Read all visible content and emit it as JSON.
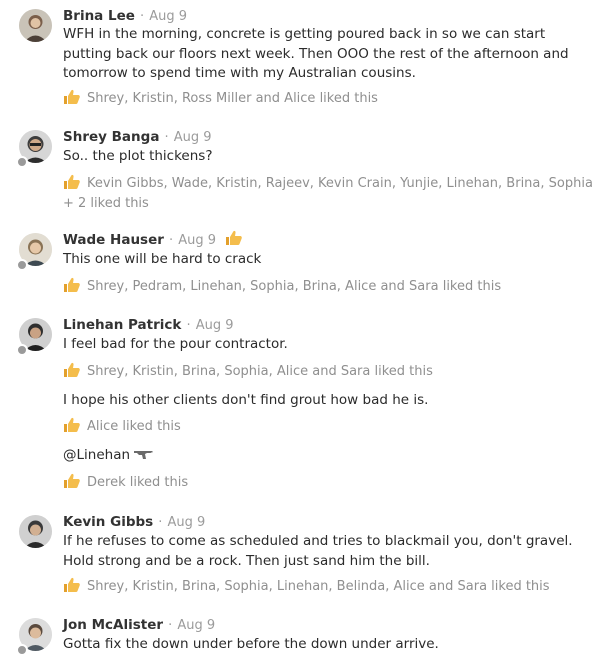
{
  "posts": [
    {
      "author": "Brina Lee",
      "date": "Aug 9",
      "message": "WFH in the morning, concrete is getting poured back in so we can start putting back our floors next week. Then OOO the rest of the afternoon and tomorrow to spend time with my Australian cousins.",
      "likes": "Shrey, Kristin, Ross Miller and Alice liked this"
    },
    {
      "author": "Shrey Banga",
      "date": "Aug 9",
      "message": "So.. the plot thickens?",
      "likes": "Kevin Gibbs, Wade, Kristin, Rajeev, Kevin Crain, Yunjie, Linehan, Brina, Sophia + 2 liked this"
    },
    {
      "author": "Wade Hauser",
      "date": "Aug 9",
      "message": "This one will be hard to crack",
      "likes": "Shrey, Pedram, Linehan, Sophia, Brina, Alice and Sara liked this"
    },
    {
      "author": "Linehan Patrick",
      "date": "Aug 9",
      "message": "I feel bad for the pour contractor.",
      "likes": "Shrey, Kristin, Brina, Sophia, Alice and Sara liked this",
      "message2": "I hope his other clients don't find grout how bad he is.",
      "likes2": "Alice liked this",
      "message3": "@Linehan",
      "likes3": "Derek liked this"
    },
    {
      "author": "Kevin Gibbs",
      "date": "Aug 9",
      "message": "If he refuses to come as scheduled and tries to blackmail you, don't gravel. Hold strong and be a rock. Then just sand him the bill.",
      "likes": "Shrey, Kristin, Brina, Sophia, Linehan, Belinda, Alice and Sara liked this"
    },
    {
      "author": "Jon McAlister",
      "date": "Aug 9",
      "message": "Gotta fix the down under before the down under arrive."
    }
  ],
  "separator": "·",
  "icons": {
    "like": "thumbs-up-icon",
    "gun": "water-pistol-icon"
  },
  "colors": {
    "thumb": "#f2b53f",
    "meta": "#9b9b9b",
    "likes_text": "#8f8f8f"
  }
}
